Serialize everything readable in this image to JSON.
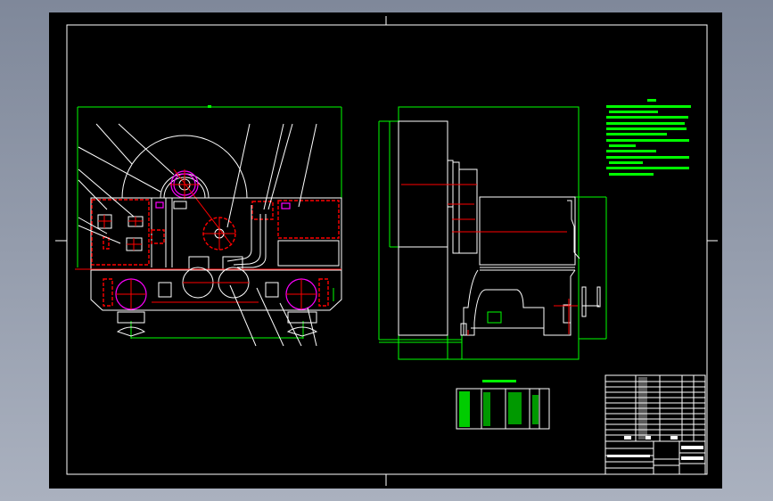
{
  "viewer": {
    "background_color": "#9aa2b2",
    "sheet_color": "#000000"
  },
  "layer_colors": {
    "outline": "#ffffff",
    "centerline": "#ff0000",
    "dimension": "#00ff00",
    "hidden": "#ff00ff"
  },
  "drawing": {
    "views": [
      "front-view",
      "side-view"
    ],
    "notes_legible": false,
    "title_block_legible": false
  }
}
